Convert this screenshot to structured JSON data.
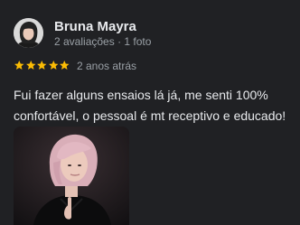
{
  "review": {
    "author_name": "Bruna Mayra",
    "review_count": "2 avaliações",
    "separator": "·",
    "photo_count": "1 foto",
    "rating": 5,
    "rating_max": 5,
    "date": "2 anos atrás",
    "text": "Fui fazer alguns ensaios lá já, me senti 100% confortável, o pessoal é mt receptivo e educado!"
  },
  "colors": {
    "background": "#202124",
    "star": "#fbbc04",
    "primary_text": "#e8eaed",
    "secondary_text": "#9aa0a6"
  },
  "icons": {
    "avatar": "profile-photo",
    "star": "star-icon",
    "attached_photo": "review-photo"
  }
}
